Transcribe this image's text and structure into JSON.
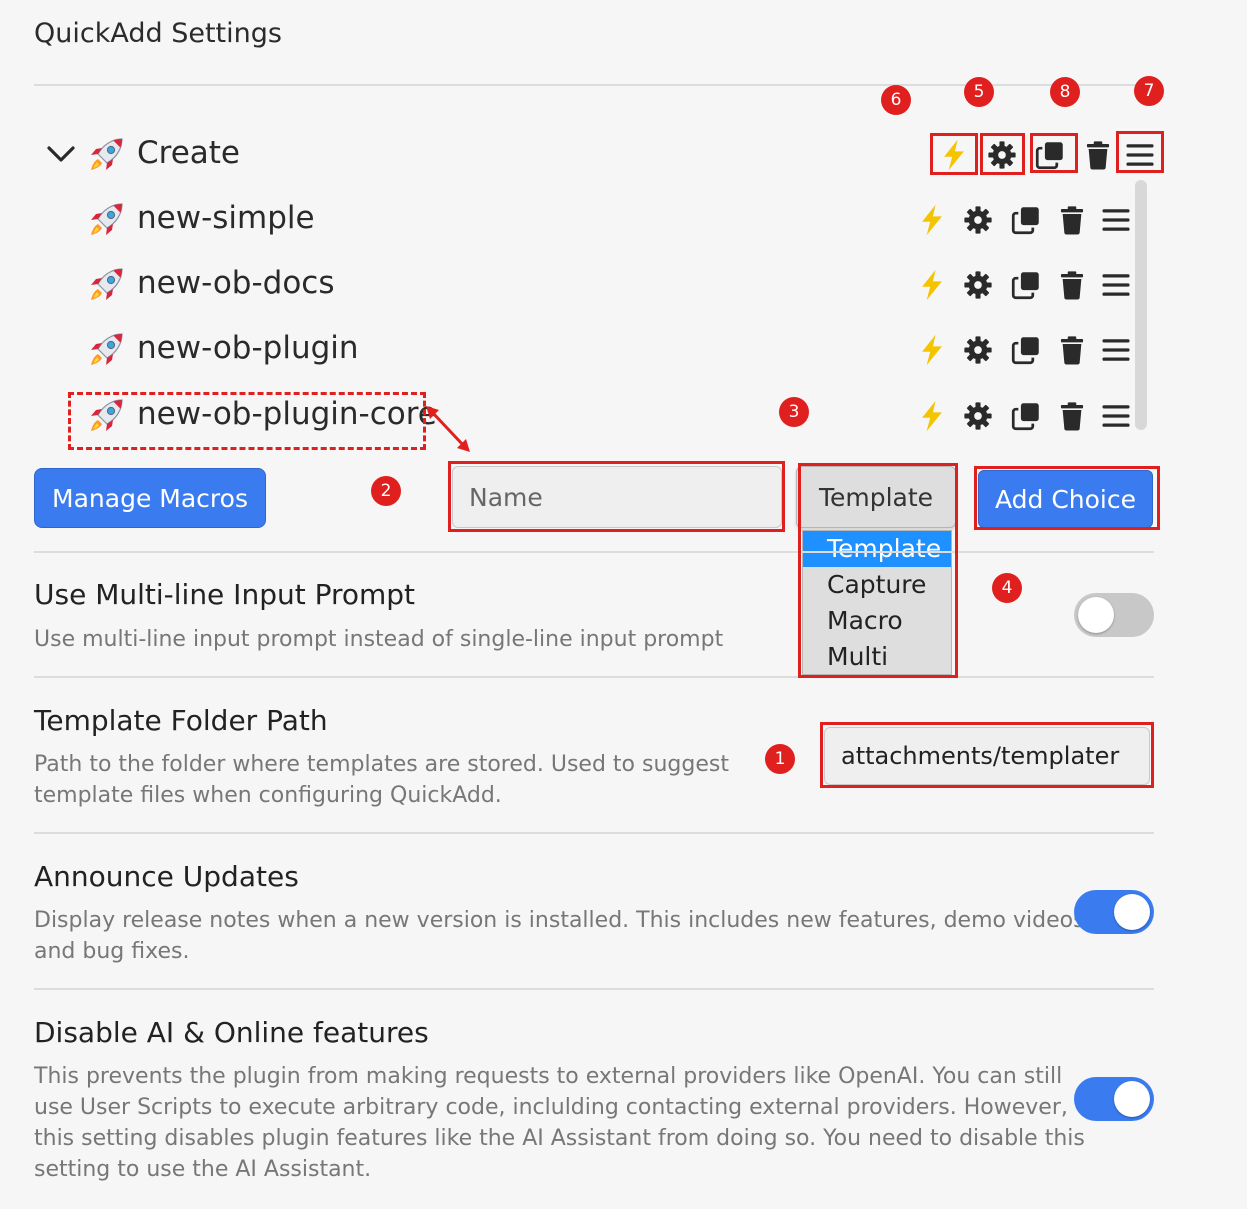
{
  "page": {
    "title": "QuickAdd Settings"
  },
  "choices": {
    "group": {
      "label": "Create",
      "icon": "rocket-icon",
      "expanded": true
    },
    "items": [
      {
        "label": "new-simple",
        "icon": "rocket-icon"
      },
      {
        "label": "new-ob-docs",
        "icon": "rocket-icon"
      },
      {
        "label": "new-ob-plugin",
        "icon": "rocket-icon"
      },
      {
        "label": "new-ob-plugin-core",
        "icon": "rocket-icon"
      }
    ],
    "action_icons": [
      "lightning-icon",
      "gear-icon",
      "duplicate-icon",
      "trash-icon",
      "drag-handle-icon"
    ]
  },
  "add_choice_bar": {
    "manage_macros_label": "Manage Macros",
    "name_placeholder": "Name",
    "type_selected": "Template",
    "type_options": [
      "Template",
      "Capture",
      "Macro",
      "Multi"
    ],
    "add_choice_label": "Add Choice"
  },
  "settings": {
    "multiline": {
      "name": "Use Multi-line Input Prompt",
      "desc": "Use multi-line input prompt instead of single-line input prompt",
      "enabled": false
    },
    "template_folder": {
      "name": "Template Folder Path",
      "desc_line1": "Path to the folder where templates are stored. Used to suggest",
      "desc_line2": "template files when configuring QuickAdd.",
      "value": "attachments/templater"
    },
    "announce_updates": {
      "name": "Announce Updates",
      "desc_line1": "Display release notes when a new version is installed. This includes new features, demo videos,",
      "desc_line2": "and bug fixes.",
      "enabled": true
    },
    "disable_ai": {
      "name": "Disable AI & Online features",
      "desc_line1": "This prevents the plugin from making requests to external providers like OpenAI. You can still",
      "desc_line2": "use User Scripts to execute arbitrary code, inclulding contacting external providers. However,",
      "desc_line3": "this setting disables plugin features like the AI Assistant from doing so. You need to disable this",
      "desc_line4": "setting to use the AI Assistant.",
      "enabled": true
    }
  },
  "annotations": {
    "markers": [
      "1",
      "2",
      "3",
      "4",
      "5",
      "6",
      "7",
      "8"
    ],
    "color": "#e0201e"
  },
  "colors": {
    "accent": "#3a7cf0",
    "lightning": "#f5c400",
    "annotation": "#e0201e"
  }
}
